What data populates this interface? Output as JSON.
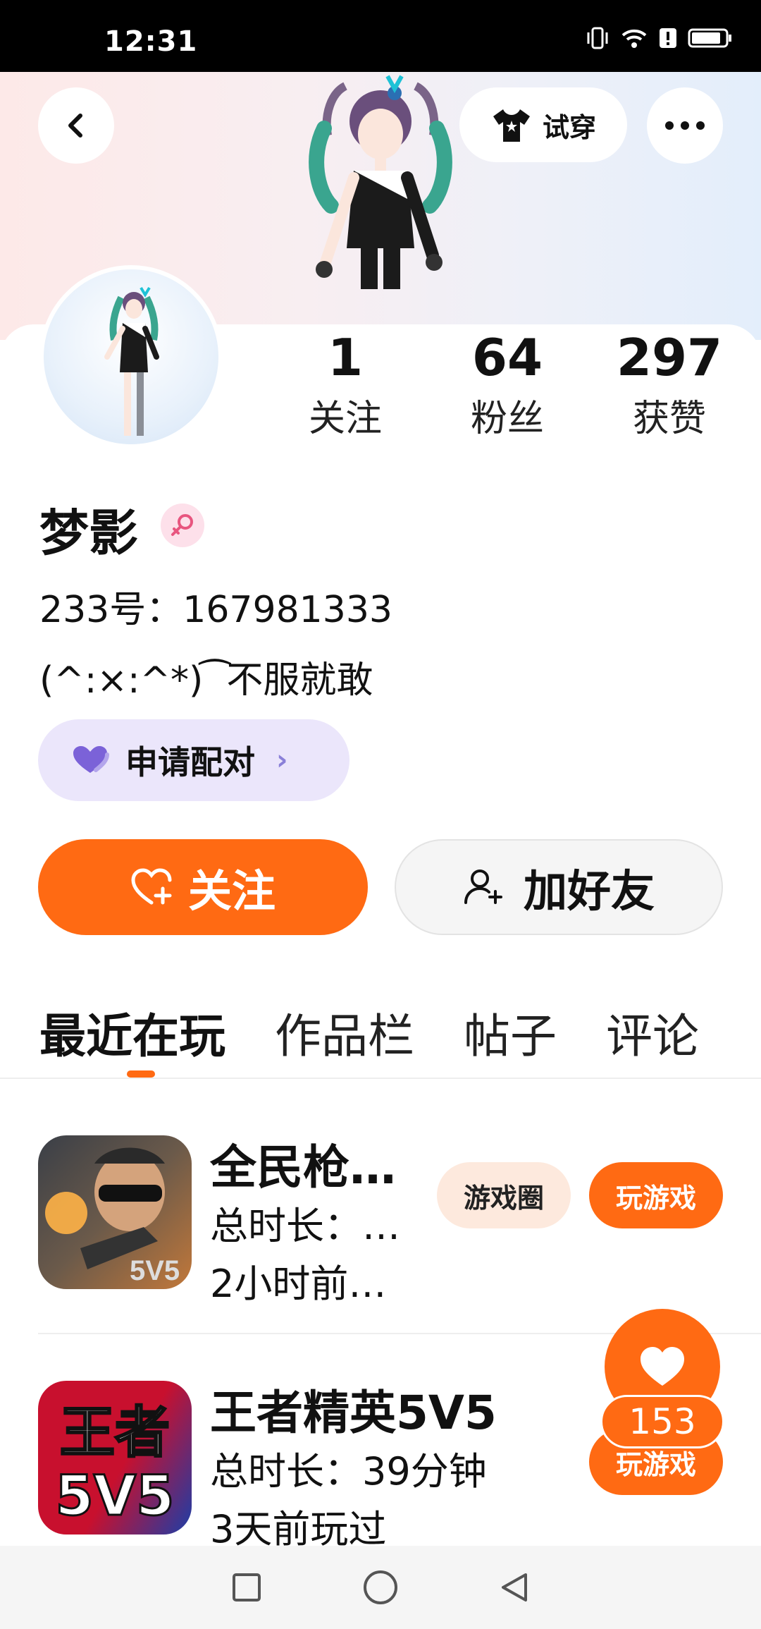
{
  "status_bar": {
    "time": "12:31"
  },
  "header": {
    "back_icon": "chevron-left-icon",
    "try_on_label": "试穿",
    "more_icon": "more-horizontal-icon"
  },
  "profile": {
    "stats": [
      {
        "value": "1",
        "label": "关注"
      },
      {
        "value": "64",
        "label": "粉丝"
      },
      {
        "value": "297",
        "label": "获赞"
      }
    ],
    "name": "梦影",
    "gender_icon": "female-icon",
    "uid": "233号：167981333",
    "bio": "(^:×:^*) ͡ 不服就敢"
  },
  "actions": {
    "pair_label": "申请配对",
    "follow_label": "关注",
    "add_friend_label": "加好友"
  },
  "tabs": [
    {
      "label": "最近在玩",
      "active": true
    },
    {
      "label": "作品栏",
      "active": false
    },
    {
      "label": "帖子",
      "active": false
    },
    {
      "label": "评论",
      "active": false
    }
  ],
  "games": [
    {
      "title": "全民枪…",
      "duration": "总时长：…",
      "last_played": "2小时前…",
      "circle_label": "游戏圈",
      "play_label": "玩游戏"
    },
    {
      "title": "王者精英5V5",
      "duration": "总时长：39分钟",
      "last_played": "3天前玩过",
      "play_label": "玩游戏"
    }
  ],
  "floating_like": {
    "count": "153"
  },
  "colors": {
    "accent": "#ff6a13",
    "pair_bg": "#ebe6fb",
    "circle_pill_bg": "#fde9dd"
  }
}
